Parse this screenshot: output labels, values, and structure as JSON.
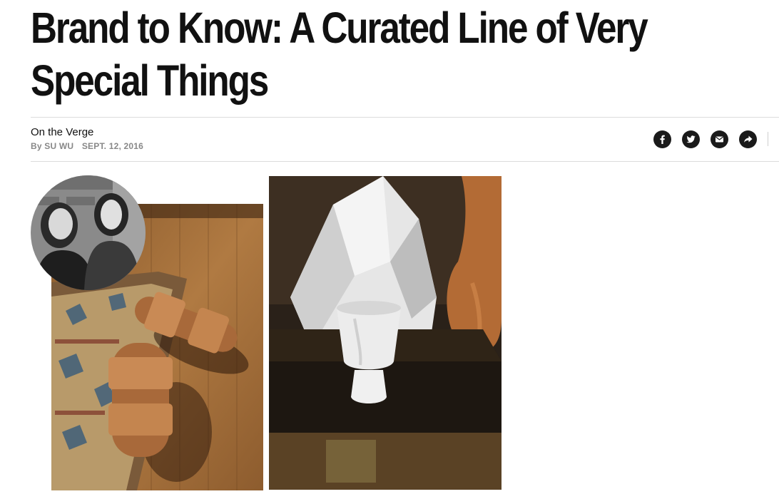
{
  "article": {
    "headline": "Brand to Know: A Curated Line of Very Special Things",
    "section": "On the Verge",
    "byline_prefix": "By",
    "author": "SU WU",
    "date": "SEPT. 12, 2016"
  },
  "share": {
    "icons": [
      "facebook-icon",
      "twitter-icon",
      "email-icon",
      "share-icon"
    ]
  },
  "colors": {
    "text": "#111111",
    "meta": "#888888",
    "share_bg": "#1a1a1a",
    "rule": "#dcdcdc"
  }
}
